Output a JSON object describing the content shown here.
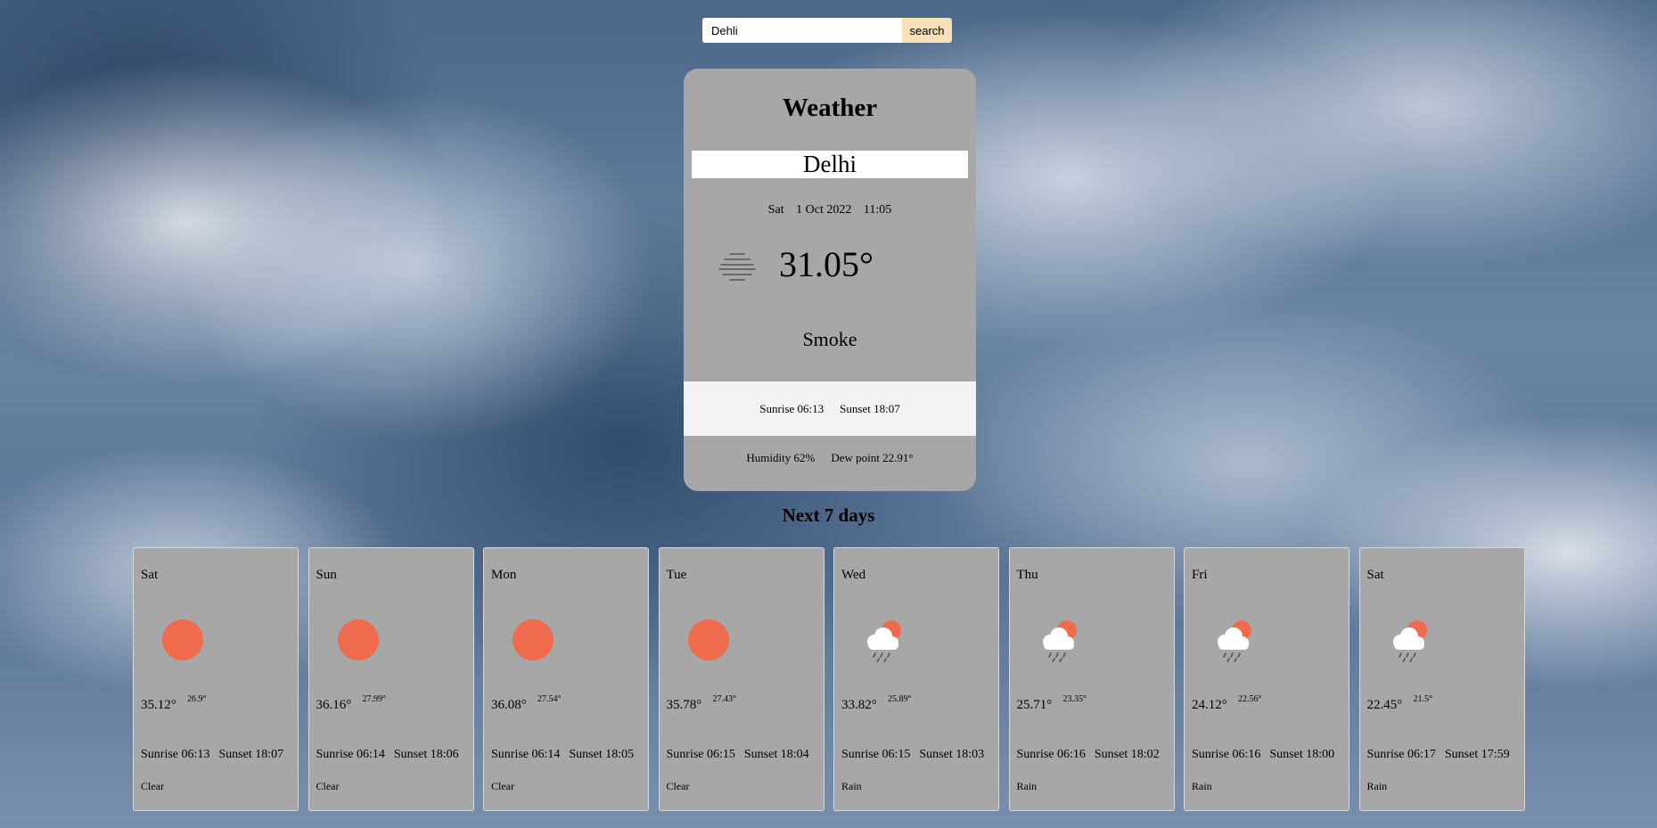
{
  "search": {
    "value": "Dehli",
    "button_label": "search"
  },
  "current": {
    "title": "Weather",
    "city": "Delhi",
    "day": "Sat",
    "date": "1 Oct 2022",
    "time": "11:05",
    "icon": "haze-icon",
    "temperature": "31.05°",
    "condition": "Smoke",
    "sunrise": "Sunrise 06:13",
    "sunset": "Sunset 18:07",
    "humidity": "Humidity 62%",
    "dew_point": "Dew point 22.91°"
  },
  "forecast": {
    "heading": "Next 7 days",
    "days": [
      {
        "name": "Sat",
        "icon": "sun-icon",
        "max": "35.12°",
        "min": "26.9°",
        "sunrise": "Sunrise 06:13",
        "sunset": "Sunset 18:07",
        "condition": "Clear"
      },
      {
        "name": "Sun",
        "icon": "sun-icon",
        "max": "36.16°",
        "min": "27.99°",
        "sunrise": "Sunrise 06:14",
        "sunset": "Sunset 18:06",
        "condition": "Clear"
      },
      {
        "name": "Mon",
        "icon": "sun-icon",
        "max": "36.08°",
        "min": "27.54°",
        "sunrise": "Sunrise 06:14",
        "sunset": "Sunset 18:05",
        "condition": "Clear"
      },
      {
        "name": "Tue",
        "icon": "sun-icon",
        "max": "35.78°",
        "min": "27.43°",
        "sunrise": "Sunrise 06:15",
        "sunset": "Sunset 18:04",
        "condition": "Clear"
      },
      {
        "name": "Wed",
        "icon": "rain-sun-icon",
        "max": "33.82°",
        "min": "25.89°",
        "sunrise": "Sunrise 06:15",
        "sunset": "Sunset 18:03",
        "condition": "Rain"
      },
      {
        "name": "Thu",
        "icon": "rain-sun-icon",
        "max": "25.71°",
        "min": "23.35°",
        "sunrise": "Sunrise 06:16",
        "sunset": "Sunset 18:02",
        "condition": "Rain"
      },
      {
        "name": "Fri",
        "icon": "rain-sun-icon",
        "max": "24.12°",
        "min": "22.56°",
        "sunrise": "Sunrise 06:16",
        "sunset": "Sunset 18:00",
        "condition": "Rain"
      },
      {
        "name": "Sat",
        "icon": "rain-sun-icon",
        "max": "22.45°",
        "min": "21.5°",
        "sunrise": "Sunrise 06:17",
        "sunset": "Sunset 17:59",
        "condition": "Rain"
      }
    ]
  },
  "colors": {
    "sun": "#ee6c4d",
    "card": "#a7a7a7",
    "search_button": "#f7e0b7"
  }
}
